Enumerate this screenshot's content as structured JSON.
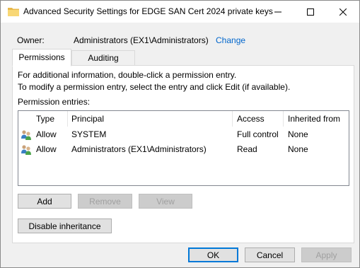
{
  "window": {
    "title": "Advanced Security Settings for EDGE SAN Cert 2024 private keys",
    "icon": "folder-icon",
    "controls": [
      "minimize-icon",
      "maximize-icon",
      "close-icon"
    ]
  },
  "owner": {
    "label": "Owner:",
    "value": "Administrators (EX1\\Administrators)",
    "change_link": "Change"
  },
  "tabs": [
    {
      "label": "Permissions",
      "active": true
    },
    {
      "label": "Auditing",
      "active": false
    }
  ],
  "permissions": {
    "info_line1": "For additional information, double-click a permission entry.",
    "info_line2": "To modify a permission entry, select the entry and click Edit (if available).",
    "entries_label": "Permission entries:",
    "columns": [
      "Type",
      "Principal",
      "Access",
      "Inherited from"
    ],
    "rows": [
      {
        "icon": "users-icon",
        "type": "Allow",
        "principal": "SYSTEM",
        "access": "Full control",
        "inherited_from": "None"
      },
      {
        "icon": "users-icon",
        "type": "Allow",
        "principal": "Administrators (EX1\\Administrators)",
        "access": "Read",
        "inherited_from": "None"
      }
    ],
    "buttons": {
      "add": "Add",
      "remove": "Remove",
      "view": "View",
      "disable_inheritance": "Disable inheritance"
    }
  },
  "footer": {
    "ok": "OK",
    "cancel": "Cancel",
    "apply": "Apply"
  },
  "colors": {
    "link": "#0066cc",
    "default_button_border": "#0078d7",
    "folder": "#f8d775"
  }
}
